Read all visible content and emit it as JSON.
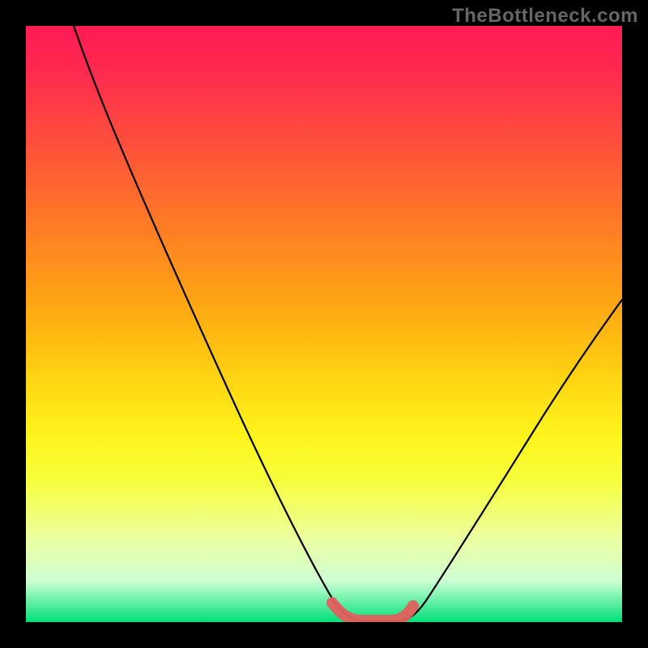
{
  "watermark": "TheBottleneck.com",
  "chart_data": {
    "type": "line",
    "title": "",
    "xlabel": "",
    "ylabel": "",
    "xlim": [
      0,
      100
    ],
    "ylim": [
      0,
      100
    ],
    "grid": false,
    "legend": false,
    "background_gradient": {
      "direction": "vertical",
      "stops": [
        {
          "pos": 0,
          "color": "#ff1a55"
        },
        {
          "pos": 50,
          "color": "#ffd012"
        },
        {
          "pos": 75,
          "color": "#fff21a"
        },
        {
          "pos": 100,
          "color": "#00e07a"
        }
      ]
    },
    "series": [
      {
        "name": "bottleneck-curve",
        "x": [
          8,
          12,
          16,
          20,
          25,
          30,
          35,
          40,
          45,
          50,
          52,
          55,
          58,
          60,
          62,
          65,
          70,
          75,
          80,
          85,
          90,
          95,
          100
        ],
        "y": [
          100,
          94,
          87,
          79,
          69,
          58,
          47,
          35,
          23,
          10,
          5,
          1,
          0,
          0,
          1,
          4,
          11,
          20,
          28,
          36,
          43,
          49,
          54
        ],
        "color": "#000000"
      }
    ],
    "highlight": {
      "name": "optimal-range",
      "color": "#e1605d",
      "x_range": [
        51,
        63
      ],
      "y": 0
    }
  }
}
